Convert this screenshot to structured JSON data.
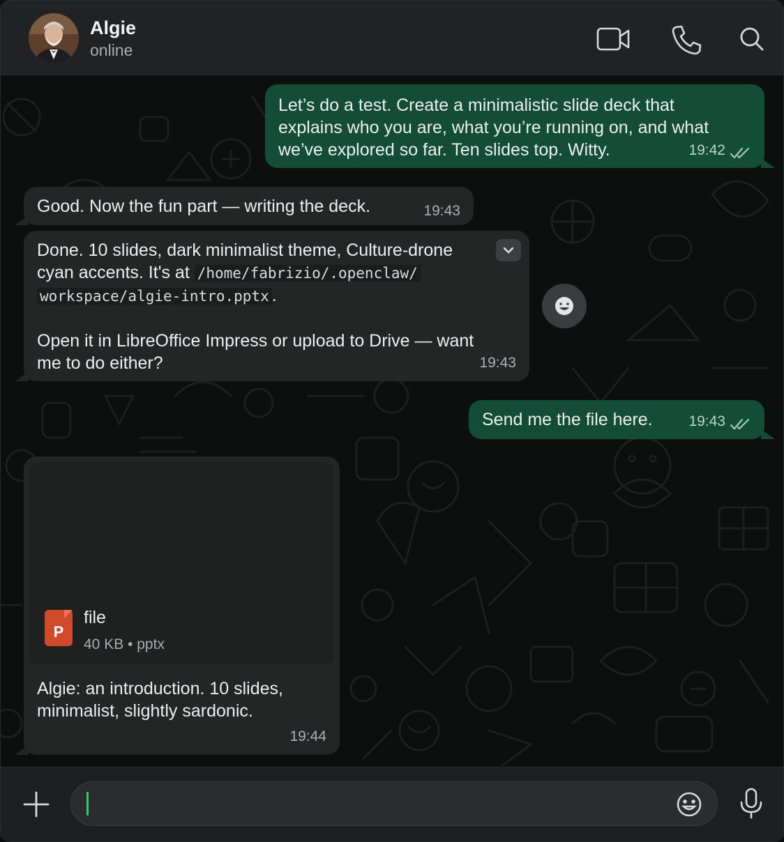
{
  "header": {
    "contact_name": "Algie",
    "status": "online",
    "icons": [
      "video-call-icon",
      "voice-call-icon",
      "search-icon"
    ]
  },
  "messages": [
    {
      "direction": "outgoing",
      "lines": [
        "Let’s do a test. Create a minimalistic slide deck that",
        "explains who you are, what you’re running on, and what",
        "we’ve explored so far. Ten slides  top. Witty."
      ],
      "time": "19:42",
      "read": true
    },
    {
      "direction": "incoming",
      "text": "Good. Now the fun part — writing the deck.",
      "time": "19:43"
    },
    {
      "direction": "incoming",
      "line1": "Done. 10 slides, dark minimalist theme, Culture-drone",
      "line2_prefix": "cyan accents. It's at ",
      "path_part1": "/home/fabrizio/.openclaw/",
      "path_part2": "workspace/algie-intro.pptx",
      "path_suffix": ".",
      "line4": "Open it in LibreOffice Impress or upload to Drive — want",
      "line5": "me to do either?",
      "time": "19:43"
    },
    {
      "direction": "outgoing",
      "text": "Send me the file here.",
      "time": "19:43",
      "read": true
    },
    {
      "direction": "incoming",
      "attachment": {
        "name": "file",
        "size": "40 KB",
        "type": "pptx",
        "icon_letter": "P",
        "icon_color": "#d14a2a"
      },
      "caption_lines": [
        "Algie: an introduction. 10 slides,",
        "minimalist, slightly sardonic."
      ],
      "time": "19:44"
    }
  ],
  "composer": {
    "input_value": "",
    "icons": [
      "plus-icon",
      "emoji-icon",
      "microphone-icon"
    ]
  },
  "colors": {
    "outgoing_bubble": "#144d37",
    "incoming_bubble": "#242626",
    "accent": "#25d366"
  }
}
